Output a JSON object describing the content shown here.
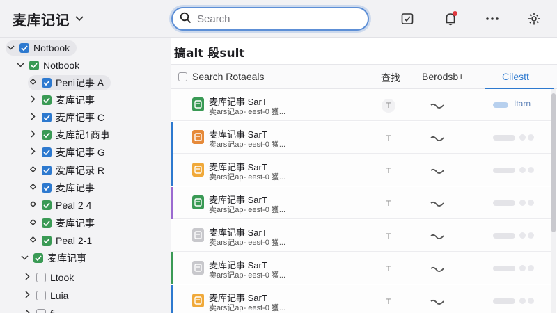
{
  "app": {
    "title": "麦库记记"
  },
  "search": {
    "placeholder": "Search",
    "value": ""
  },
  "toolbar": {
    "icons": [
      "tray-check-icon",
      "notification-bell-icon",
      "more-icon",
      "settings-icon"
    ]
  },
  "sidebar": {
    "root": {
      "label": "Notbook"
    },
    "items": [
      {
        "label": "Notbook",
        "toggle": "expanded",
        "color": "green"
      },
      {
        "label": "Peni记事 A",
        "toggle": "diamond",
        "color": "blue"
      },
      {
        "label": "麦库记事",
        "toggle": "collapsed",
        "color": "green"
      },
      {
        "label": "麦库记事 C",
        "toggle": "collapsed",
        "color": "blue"
      },
      {
        "label": "麦库記1商事",
        "toggle": "collapsed",
        "color": "green"
      },
      {
        "label": "麦库记事 G",
        "toggle": "collapsed",
        "color": "blue"
      },
      {
        "label": "爱库记录 R",
        "toggle": "diamond",
        "color": "blue"
      },
      {
        "label": "麦库记事",
        "toggle": "diamond",
        "color": "blue"
      },
      {
        "label": "Peal 2 4",
        "toggle": "diamond",
        "color": "green"
      },
      {
        "label": "麦库记事",
        "toggle": "diamond",
        "color": "green"
      },
      {
        "label": "Peal 2-1",
        "toggle": "diamond",
        "color": "green"
      },
      {
        "label": "麦库记事",
        "toggle": "expanded",
        "color": "green"
      },
      {
        "label": "Ltook",
        "toggle": "collapsed",
        "color": "gray"
      },
      {
        "label": "Luia",
        "toggle": "collapsed",
        "color": "gray"
      },
      {
        "label": "fi·..",
        "toggle": "collapsed",
        "color": "gray"
      }
    ]
  },
  "main": {
    "title": "搞alt 段sult",
    "columns": {
      "search": "Search Rotaeals",
      "c2": "查找",
      "c3": "Berodsb+",
      "c4": "Cilestt"
    },
    "rows": [
      {
        "title": "麦库记事 SarT",
        "subtitle": "卖ars记ap- eest-0 獲...",
        "t": "T",
        "status": "Itarn",
        "icon_color": "#3a9a55",
        "accent": "none"
      },
      {
        "title": "麦库记事 SarT",
        "subtitle": "卖ars记ap- eest-0 獲...",
        "t": "T",
        "status": "",
        "icon_color": "#e68a3a",
        "accent": "#2d79cf"
      },
      {
        "title": "麦库记事 SarT",
        "subtitle": "卖ars记ap- eest-0 獲...",
        "t": "T",
        "status": "",
        "icon_color": "#f0a93a",
        "accent": "#2d79cf"
      },
      {
        "title": "麦库记事 SarT",
        "subtitle": "卖ars记ap- eest-0 獲...",
        "t": "T",
        "status": "",
        "icon_color": "#3a9a55",
        "accent": "#9b6ad0"
      },
      {
        "title": "麦库记事 SarT",
        "subtitle": "卖ars记ap- eest-0 獲...",
        "t": "T",
        "status": "",
        "icon_color": "#c8c8cc",
        "accent": "none"
      },
      {
        "title": "麦库记事 SarT",
        "subtitle": "卖ars记ap- eest-0 獲...",
        "t": "T",
        "status": "",
        "icon_color": "#c8c8cc",
        "accent": "#3a9a55"
      },
      {
        "title": "麦库记事 SarT",
        "subtitle": "卖ars记ap- eest-0 獲...",
        "t": "T",
        "status": "",
        "icon_color": "#f0a93a",
        "accent": "#2d79cf"
      }
    ]
  },
  "colors": {
    "accent": "#2d79cf",
    "green": "#3a9a55",
    "badge": "#e0383e"
  }
}
